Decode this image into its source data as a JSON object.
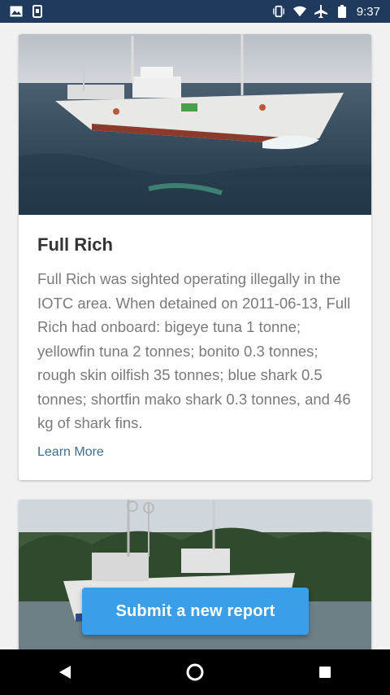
{
  "status_bar": {
    "time": "9:37",
    "icons": [
      "image-icon",
      "sim-icon",
      "vibrate-icon",
      "wifi-icon",
      "airplane-icon",
      "battery-icon"
    ]
  },
  "cards": [
    {
      "title": "Full Rich",
      "description": "Full Rich was sighted operating illegally in the IOTC area. When detained on 2011-06-13, Full Rich had onboard: bigeye tuna 1 tonne; yellowfin tuna 2 tonnes; bonito 0.3 tonnes; rough skin oilfish 35 tonnes; blue shark 0.5 tonnes; shortfin mako shark 0.3 tonnes, and 46 kg of shark fins.",
      "link": "Learn More",
      "image": "fishing-vessel-at-sea-photo"
    },
    {
      "image": "fishing-vessel-near-shore-photo"
    }
  ],
  "fab": {
    "label": "Submit a new report"
  },
  "nav": {
    "icons": [
      "back-icon",
      "home-icon",
      "recents-icon"
    ]
  },
  "colors": {
    "status_bar": "#1f3a5c",
    "fab": "#3b9ee8",
    "link": "#3a6e93",
    "title": "#333333",
    "body_text": "#7a7a7a"
  }
}
